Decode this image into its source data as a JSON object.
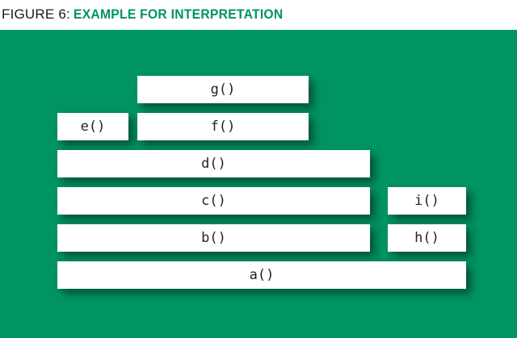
{
  "header": {
    "figure_label": "FIGURE 6:",
    "title": "EXAMPLE FOR INTERPRETATION"
  },
  "colors": {
    "background": "#009462",
    "accent": "#00935f",
    "box": "#ffffff"
  },
  "diagram": {
    "boxes": [
      {
        "id": "g",
        "label": "g()"
      },
      {
        "id": "e",
        "label": "e()"
      },
      {
        "id": "f",
        "label": "f()"
      },
      {
        "id": "d",
        "label": "d()"
      },
      {
        "id": "c",
        "label": "c()"
      },
      {
        "id": "i",
        "label": "i()"
      },
      {
        "id": "b",
        "label": "b()"
      },
      {
        "id": "h",
        "label": "h()"
      },
      {
        "id": "a",
        "label": "a()"
      }
    ]
  }
}
